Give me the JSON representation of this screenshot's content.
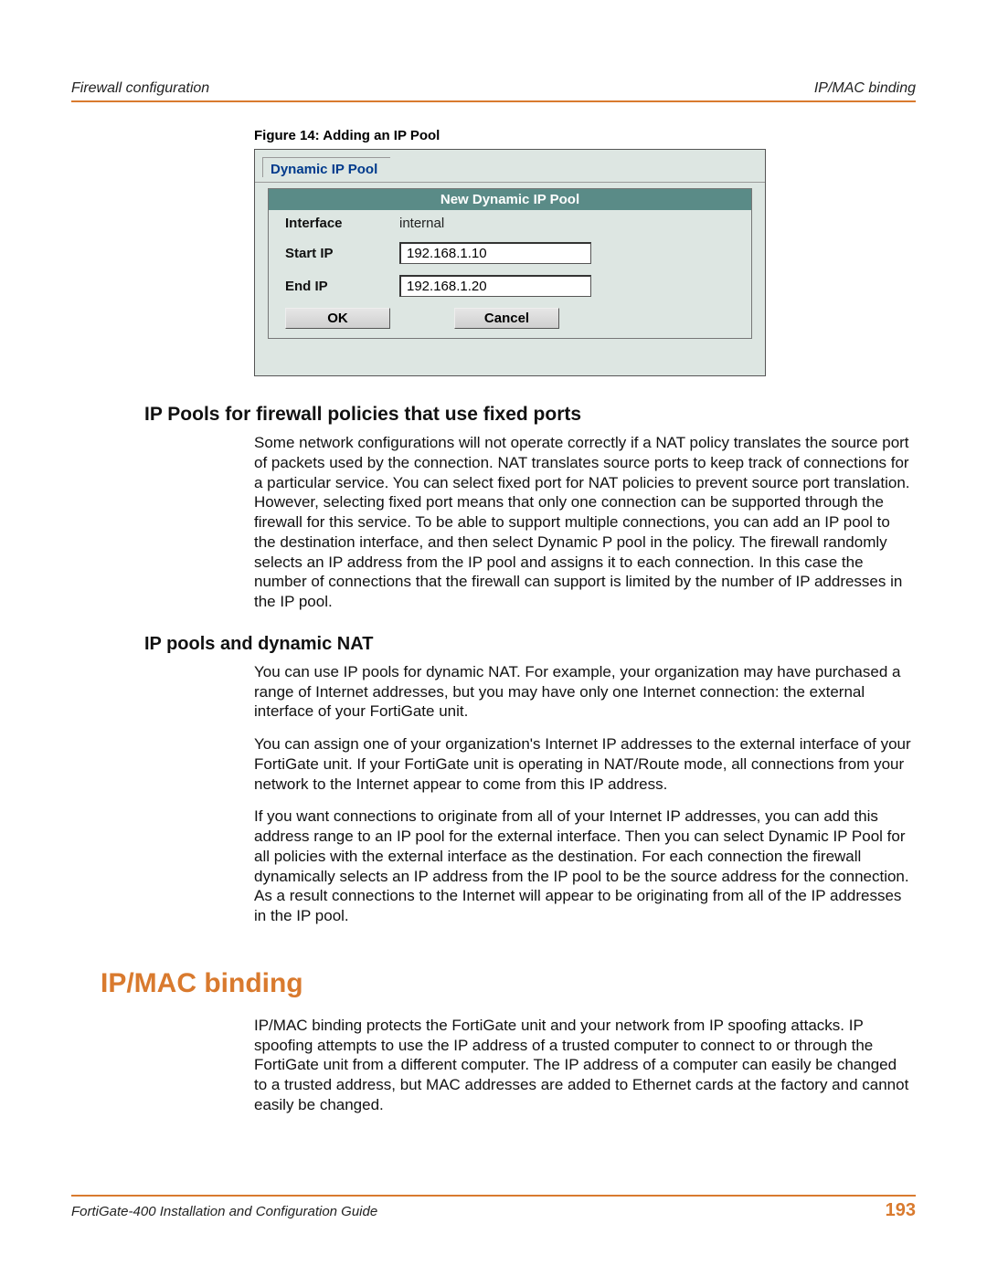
{
  "header": {
    "left": "Firewall configuration",
    "right": "IP/MAC binding"
  },
  "figure": {
    "caption": "Figure 14: Adding an IP Pool",
    "tab_label": "Dynamic IP Pool",
    "panel_title": "New Dynamic IP Pool",
    "rows": {
      "interface_label": "Interface",
      "interface_value": "internal",
      "startip_label": "Start IP",
      "startip_value": "192.168.1.10",
      "endip_label": "End IP",
      "endip_value": "192.168.1.20"
    },
    "buttons": {
      "ok": "OK",
      "cancel": "Cancel"
    }
  },
  "section1": {
    "heading": "IP Pools for firewall policies that use fixed ports",
    "p1": "Some network configurations will not operate correctly if a NAT policy translates the source port of packets used by the connection. NAT translates source ports to keep track of connections for a particular service. You can select fixed port for NAT policies to prevent source port translation. However, selecting fixed port means that only one connection can be supported through the firewall for this service. To be able to support multiple connections, you can add an IP pool to the destination interface, and then select Dynamic P pool in the policy. The firewall randomly selects an IP address from the IP pool and assigns it to each connection. In this case the number of connections that the firewall can support is limited by the number of IP addresses in the IP pool."
  },
  "section2": {
    "heading": "IP pools and dynamic NAT",
    "p1": "You can use IP pools for dynamic NAT. For example, your organization may have purchased a range of Internet addresses, but you may have only one Internet connection: the external interface of your FortiGate unit.",
    "p2": "You can assign one of your organization's Internet IP addresses to the external interface of your FortiGate unit. If your FortiGate unit is operating in NAT/Route mode, all connections from your network to the Internet appear to come from this IP address.",
    "p3": "If you want connections to originate from all of your Internet IP addresses, you can add this address range to an IP pool for the external interface. Then you can select Dynamic IP Pool for all policies with the external interface as the destination. For each connection the firewall dynamically selects an IP address from the IP pool to be the source address for the connection. As a result connections to the Internet will appear to be originating from all of the IP addresses in the IP pool."
  },
  "main_heading": "IP/MAC binding",
  "section3": {
    "p1": "IP/MAC binding protects the FortiGate unit and your network from IP spoofing attacks. IP spoofing attempts to use the IP address of a trusted computer to connect to or through the FortiGate unit from a different computer. The IP address of a computer can easily be changed to a trusted address, but MAC addresses are added to Ethernet cards at the factory and cannot easily be changed."
  },
  "footer": {
    "left": "FortiGate-400 Installation and Configuration Guide",
    "page": "193"
  }
}
